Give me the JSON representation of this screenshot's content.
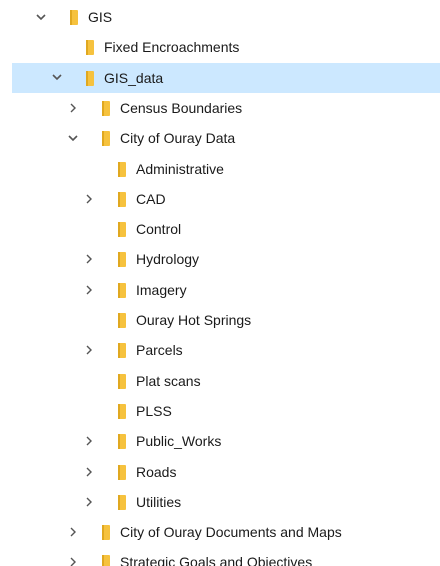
{
  "colors": {
    "selection": "#cce8ff",
    "folder": "#f6c23e",
    "folder_dark": "#e0a820",
    "chevron": "#555555",
    "text": "#1a1a1a"
  },
  "tree": {
    "items": [
      {
        "label": "GIS",
        "state": "expanded",
        "level": 0
      },
      {
        "label": "Fixed Encroachments",
        "state": "leaf",
        "level": 1
      },
      {
        "label": "GIS_data",
        "state": "expanded",
        "level": 1,
        "selected": true
      },
      {
        "label": "Census Boundaries",
        "state": "collapsed",
        "level": 2
      },
      {
        "label": "City of Ouray Data",
        "state": "expanded",
        "level": 2
      },
      {
        "label": "Administrative",
        "state": "leaf",
        "level": 3
      },
      {
        "label": "CAD",
        "state": "collapsed",
        "level": 3
      },
      {
        "label": "Control",
        "state": "leaf",
        "level": 3
      },
      {
        "label": "Hydrology",
        "state": "collapsed",
        "level": 3
      },
      {
        "label": "Imagery",
        "state": "collapsed",
        "level": 3
      },
      {
        "label": "Ouray Hot Springs",
        "state": "leaf",
        "level": 3
      },
      {
        "label": "Parcels",
        "state": "collapsed",
        "level": 3
      },
      {
        "label": "Plat scans",
        "state": "leaf",
        "level": 3
      },
      {
        "label": "PLSS",
        "state": "leaf",
        "level": 3
      },
      {
        "label": "Public_Works",
        "state": "collapsed",
        "level": 3
      },
      {
        "label": "Roads",
        "state": "collapsed",
        "level": 3
      },
      {
        "label": "Utilities",
        "state": "collapsed",
        "level": 3
      },
      {
        "label": "City of Ouray Documents and Maps",
        "state": "collapsed",
        "level": 2
      },
      {
        "label": "Strategic Goals and Objectives",
        "state": "collapsed",
        "level": 2
      }
    ]
  }
}
